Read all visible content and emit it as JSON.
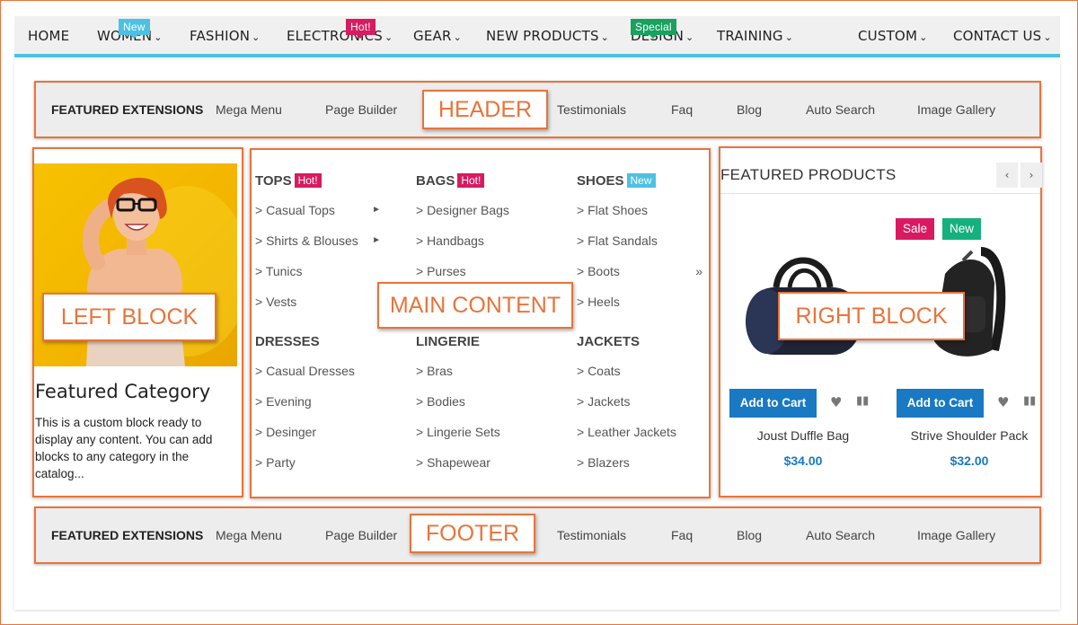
{
  "topnav": {
    "items": [
      {
        "label": "HOME",
        "chev": ""
      },
      {
        "label": "WOMEN",
        "chev": "⌄",
        "badge": "New"
      },
      {
        "label": "FASHION",
        "chev": "⌄"
      },
      {
        "label": "ELECTRONICS",
        "chev": "⌄",
        "badge": "Hot!"
      },
      {
        "label": "GEAR",
        "chev": "⌄"
      },
      {
        "label": "NEW PRODUCTS",
        "chev": "⌄"
      },
      {
        "label": "DESIGN",
        "chev": "⌄",
        "badge": "Special"
      },
      {
        "label": "TRAINING",
        "chev": "⌄"
      },
      {
        "label": "CUSTOM",
        "chev": "⌄"
      },
      {
        "label": "CONTACT US",
        "chev": "⌄"
      }
    ],
    "accent": "#4cc1e3"
  },
  "header_bar": {
    "items": [
      "FEATURED EXTENSIONS",
      "Mega Menu",
      "Page Builder",
      "Testimonials",
      "Faq",
      "Blog",
      "Auto Search",
      "Image Gallery"
    ],
    "callout": "HEADER"
  },
  "footer_bar": {
    "items": [
      "FEATURED EXTENSIONS",
      "Mega Menu",
      "Page Builder",
      "Testimonials",
      "Faq",
      "Blog",
      "Auto Search",
      "Image Gallery"
    ],
    "callout": "FOOTER"
  },
  "left_block": {
    "callout": "LEFT BLOCK",
    "title": "Featured Category",
    "description": "This is a custom block ready to display any content. You can add blocks to any category in the catalog..."
  },
  "main_content": {
    "callout": "MAIN CONTENT",
    "columns": [
      {
        "heading": "TOPS",
        "badge": "Hot!",
        "links": [
          "> Casual Tops",
          "> Shirts & Blouses",
          "> Tunics",
          "> Vests"
        ]
      },
      {
        "heading": "BAGS",
        "badge": "Hot!",
        "links": [
          "> Designer Bags",
          "> Handbags",
          "> Purses",
          ""
        ]
      },
      {
        "heading": "SHOES",
        "badge": "New",
        "links": [
          "> Flat Shoes",
          "> Flat Sandals",
          "> Boots",
          "> Heels"
        ]
      },
      {
        "heading": "DRESSES",
        "links": [
          "> Casual Dresses",
          "> Evening",
          "> Desinger",
          "> Party"
        ]
      },
      {
        "heading": "LINGERIE",
        "links": [
          "> Bras",
          "> Bodies",
          "> Lingerie Sets",
          "> Shapewear"
        ]
      },
      {
        "heading": "JACKETS",
        "links": [
          "> Coats",
          "> Jackets",
          "> Leather Jackets",
          "> Blazers"
        ]
      }
    ],
    "more_glyph": "»",
    "submenu_glyph": "►"
  },
  "right_block": {
    "callout": "RIGHT BLOCK",
    "title": "FEATURED PRODUCTS",
    "prev": "‹",
    "next": "›",
    "badges": {
      "sale": "Sale",
      "new": "New"
    },
    "products": [
      {
        "name": "Joust Duffle Bag",
        "price": "$34.00",
        "button": "Add to Cart"
      },
      {
        "name": "Strive Shoulder Pack",
        "price": "$32.00",
        "button": "Add to Cart"
      }
    ]
  },
  "colors": {
    "annotation": "#e8743a",
    "hot": "#d81b60",
    "new_nav": "#4cc1e3",
    "special": "#19a15f",
    "button": "#1979c3",
    "sale": "#d81b60",
    "new_product": "#15b07e"
  }
}
